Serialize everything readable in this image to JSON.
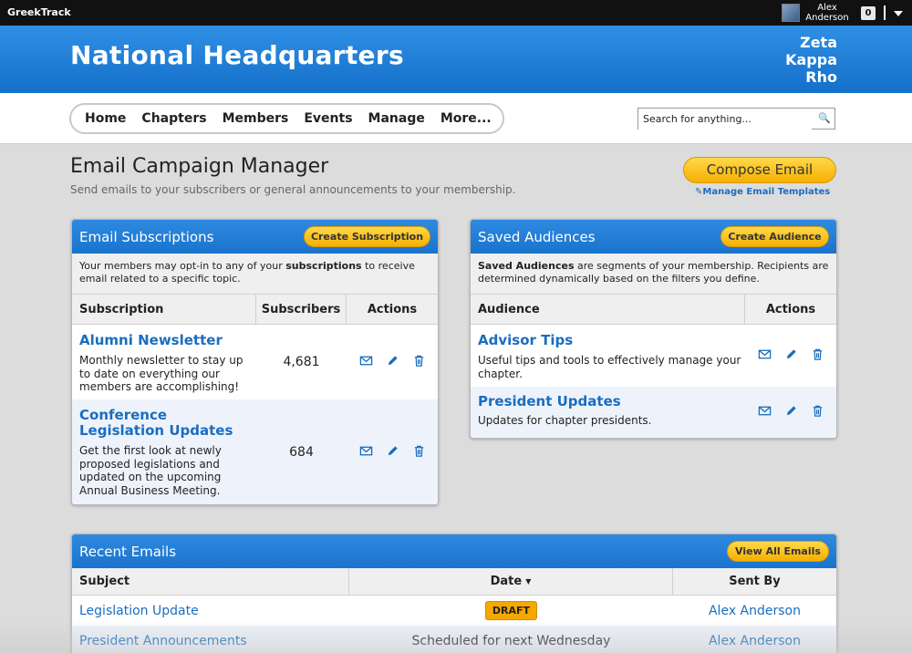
{
  "topbar": {
    "brand": "GreekTrack",
    "user_first": "Alex",
    "user_last": "Anderson",
    "notifications": "0"
  },
  "header": {
    "title": "National Headquarters",
    "org_line1": "Zeta",
    "org_line2": "Kappa",
    "org_line3": "Rho"
  },
  "nav": {
    "items": [
      "Home",
      "Chapters",
      "Members",
      "Events",
      "Manage",
      "More..."
    ],
    "search_placeholder": "Search for anything..."
  },
  "page": {
    "title": "Email Campaign Manager",
    "subtitle": "Send emails to your subscribers or general announcements to your membership.",
    "compose_label": "Compose Email",
    "manage_templates_label": "Manage Email Templates"
  },
  "subscriptions": {
    "title": "Email Subscriptions",
    "button": "Create Subscription",
    "desc_pre": "Your members may opt-in to any of your ",
    "desc_bold": "subscriptions",
    "desc_post": " to receive email related to a specific topic.",
    "columns": [
      "Subscription",
      "Subscribers",
      "Actions"
    ],
    "rows": [
      {
        "name": "Alumni Newsletter",
        "desc": "Monthly newsletter to stay up to date on everything our members are accomplishing!",
        "subscribers": "4,681"
      },
      {
        "name": "Conference Legislation Updates",
        "desc": "Get the first look at newly proposed legislations and updated on the upcoming Annual Business Meeting.",
        "subscribers": "684"
      }
    ]
  },
  "audiences": {
    "title": "Saved Audiences",
    "button": "Create Audience",
    "desc_bold": "Saved Audiences",
    "desc_post": " are segments of your membership. Recipients are determined dynamically based on the filters you define.",
    "columns": [
      "Audience",
      "Actions"
    ],
    "rows": [
      {
        "name": "Advisor Tips",
        "desc": "Useful tips and tools to effectively manage your chapter."
      },
      {
        "name": "President Updates",
        "desc": "Updates for chapter presidents."
      }
    ]
  },
  "recent": {
    "title": "Recent Emails",
    "button": "View All Emails",
    "columns": [
      "Subject",
      "Date",
      "Sent By"
    ],
    "rows": [
      {
        "subject": "Legislation Update",
        "date": "DRAFT",
        "sender": "Alex Anderson"
      },
      {
        "subject": "President Announcements",
        "date": "Scheduled for next Wednesday",
        "sender": "Alex Anderson"
      }
    ]
  },
  "icons": {
    "mail": "mail-icon",
    "edit": "pencil-icon",
    "delete": "trash-icon",
    "search": "search-icon"
  },
  "colors": {
    "header_blue": "#1a73cc",
    "link_blue": "#1a6dbf",
    "button_yellow": "#f5b000"
  }
}
